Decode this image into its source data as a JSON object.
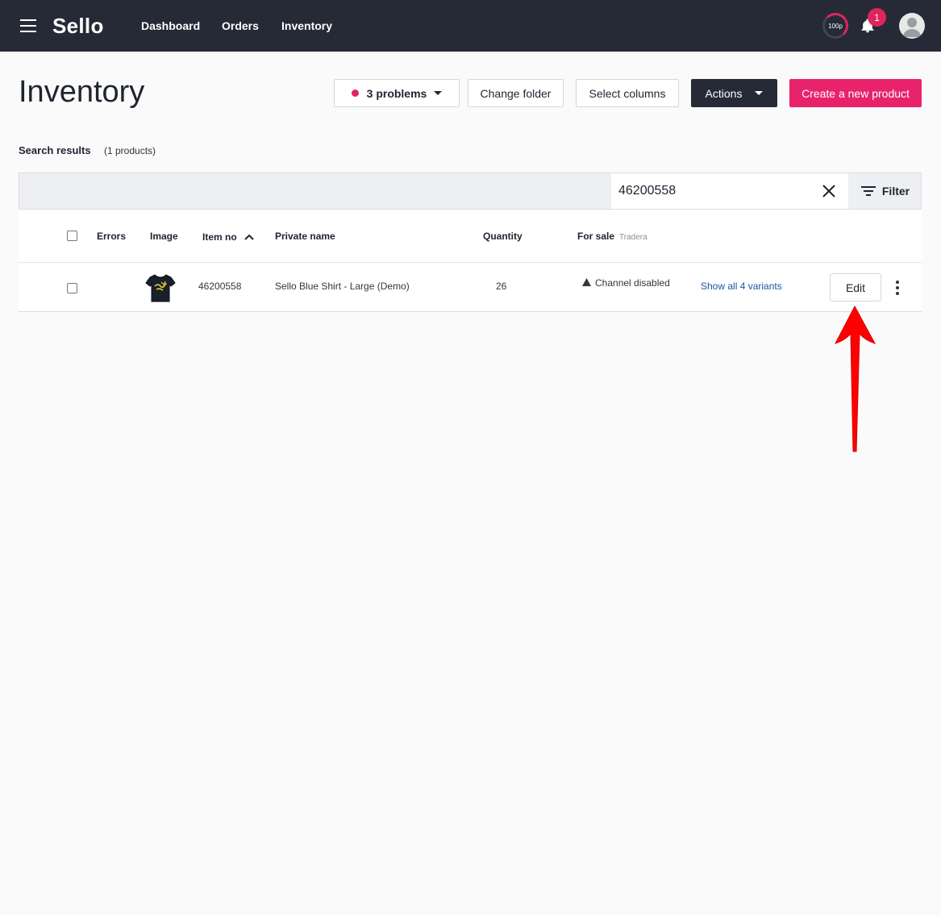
{
  "header": {
    "brand": "Sello",
    "nav": [
      "Dashboard",
      "Orders",
      "Inventory"
    ],
    "quota": "100p",
    "notifications": "1"
  },
  "page": {
    "title": "Inventory",
    "buttons": {
      "problems": "3 problems",
      "change_folder": "Change folder",
      "select_columns": "Select columns",
      "actions": "Actions",
      "create": "Create a new product"
    },
    "search_results": "Search results",
    "search_count": "(1 products)"
  },
  "search": {
    "value": "46200558",
    "filter_label": "Filter"
  },
  "table": {
    "columns": {
      "errors": "Errors",
      "image": "Image",
      "item_no": "Item no",
      "private_name": "Private name",
      "quantity": "Quantity",
      "for_sale": "For sale",
      "for_sale_sub": "Tradera"
    },
    "rows": [
      {
        "item_no": "46200558",
        "private_name": "Sello Blue Shirt - Large (Demo)",
        "quantity": "26",
        "channel_status": "Channel disabled",
        "variants_link": "Show all 4 variants",
        "edit_label": "Edit"
      }
    ]
  },
  "colors": {
    "topbar": "#262a36",
    "accent": "#e8236b",
    "annotation_arrow": "#ff0000"
  }
}
